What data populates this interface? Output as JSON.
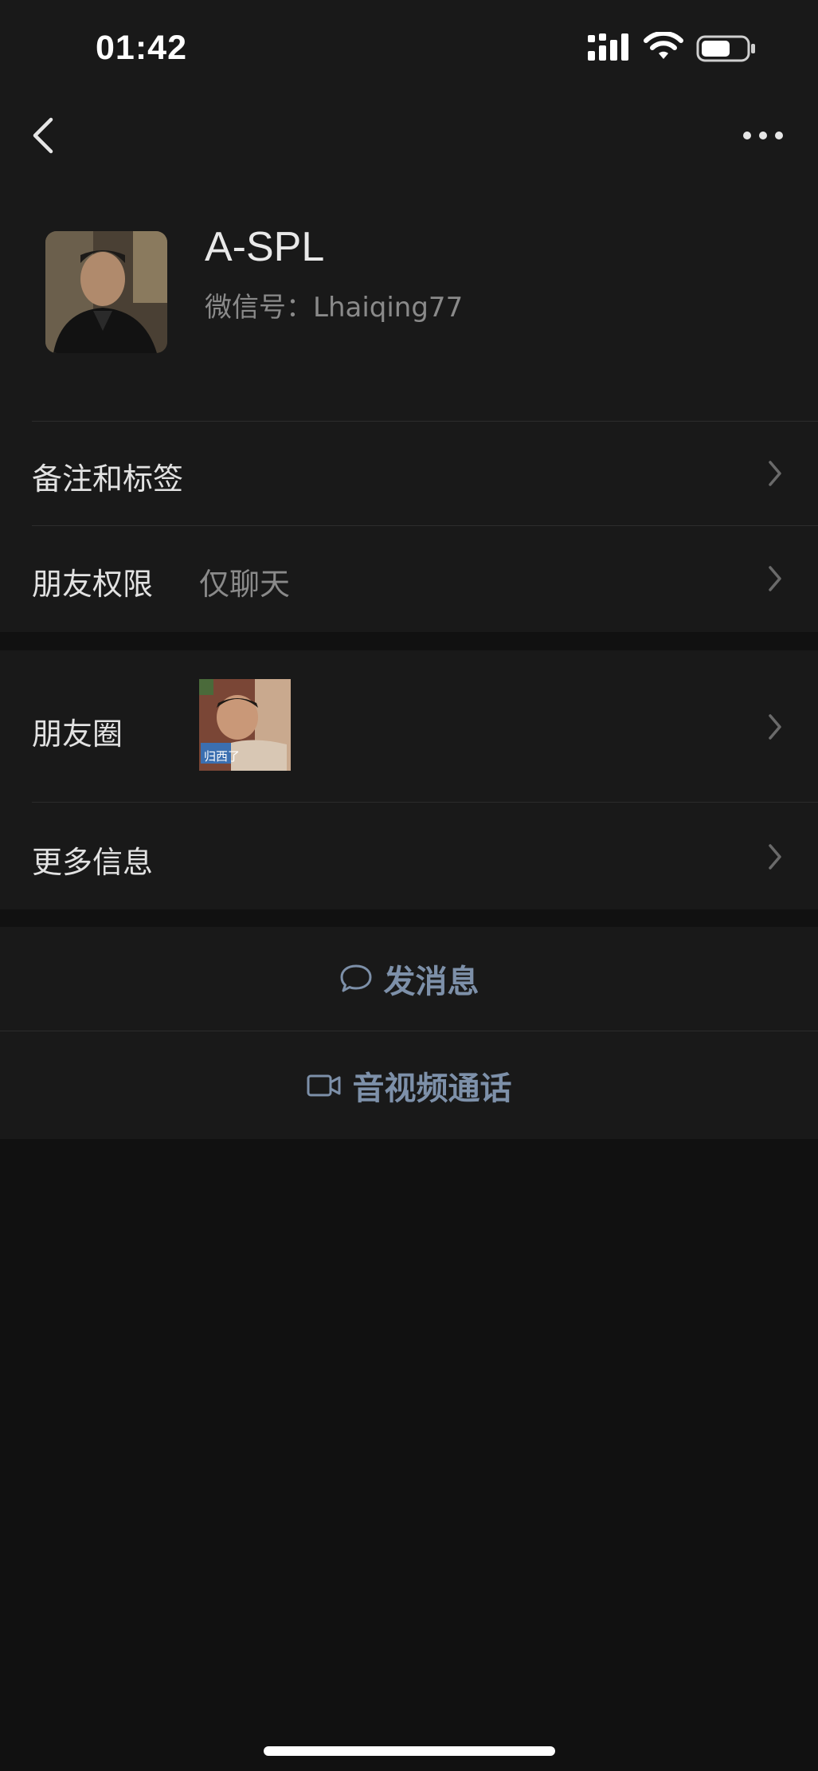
{
  "status_bar": {
    "time": "01:42",
    "icons": [
      "cellular-signal-icon",
      "wifi-icon",
      "battery-icon"
    ]
  },
  "nav": {
    "back_icon": "chevron-left-icon",
    "more_icon": "ellipsis-icon"
  },
  "profile": {
    "name": "A-SPL",
    "wechat_id": "微信号：Lhaiqing77"
  },
  "rows": {
    "remarks": {
      "label": "备注和标签"
    },
    "permissions": {
      "label": "朋友权限",
      "value": "仅聊天"
    },
    "moments": {
      "label": "朋友圈",
      "thumb_caption": "归西了"
    },
    "more_info": {
      "label": "更多信息"
    }
  },
  "actions": {
    "message": {
      "label": "发消息",
      "icon": "chat-bubble-icon"
    },
    "call": {
      "label": "音视频通话",
      "icon": "video-camera-icon"
    }
  },
  "colors": {
    "background": "#111111",
    "surface": "#191919",
    "divider": "#2c2c2c",
    "primary_text": "#e2e2e2",
    "secondary_text": "#8a8a8a",
    "action_text": "#7d90a9"
  }
}
